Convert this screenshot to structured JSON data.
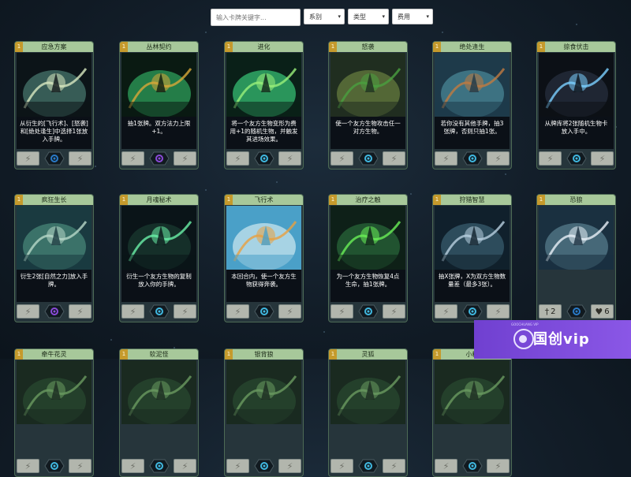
{
  "filters": {
    "search_placeholder": "输入卡牌关键字...",
    "series": "系别",
    "type": "类型",
    "cost": "费用"
  },
  "cards": [
    {
      "title": "应急方案",
      "cost": "1",
      "desc": "从衍生的[飞行术]、[怒袭]和[绝处逢生]中选择1张放入手牌。",
      "footer": "spell",
      "gem": "blue",
      "colors": [
        "#0c1418",
        "#4a7a70",
        "#d8e8c0"
      ]
    },
    {
      "title": "丛林契约",
      "cost": "1",
      "desc": "抽1张牌。双方法力上限+1。",
      "footer": "spell",
      "gem": "purple",
      "colors": [
        "#0a1a12",
        "#2fa860",
        "#d8a838"
      ]
    },
    {
      "title": "进化",
      "cost": "1",
      "desc": "将一个友方生物变形为费用+1的随机生物，并触发其进场效果。",
      "footer": "spell",
      "gem": "cyan",
      "colors": [
        "#0a2018",
        "#38c878",
        "#9af07a"
      ]
    },
    {
      "title": "怒袭",
      "cost": "1",
      "desc": "使一个友方生物攻击任一对方生物。",
      "footer": "spell",
      "gem": "cyan",
      "colors": [
        "#202e20",
        "#6a8040",
        "#4aa040"
      ]
    },
    {
      "title": "绝处逢生",
      "cost": "1",
      "desc": "若你没有其他手牌，抽3张牌，否则只抽1张。",
      "footer": "spell",
      "gem": "cyan",
      "colors": [
        "#1e3a4a",
        "#4a8a9a",
        "#c07a40"
      ]
    },
    {
      "title": "掠食伏击",
      "cost": "1",
      "desc": "从牌库将2张随机生物卡放入手中。",
      "footer": "spell",
      "gem": "cyan",
      "colors": [
        "#0c1016",
        "#283040",
        "#7ad0ff"
      ]
    },
    {
      "title": "疯狂生长",
      "cost": "1",
      "desc": "衍生2张[自然之力]放入手牌。",
      "footer": "spell",
      "gem": "purple",
      "colors": [
        "#1a3a40",
        "#4a8a7a",
        "#b8d8c8"
      ]
    },
    {
      "title": "月魂秘术",
      "cost": "1",
      "desc": "衍生一个友方生物的复制放入你的手牌。",
      "footer": "spell",
      "gem": "cyan",
      "colors": [
        "#0a1418",
        "#1a3a30",
        "#6af0a8"
      ]
    },
    {
      "title": "飞行术",
      "cost": "1",
      "desc": "本回合内，使一个友方生物获得奔袭。",
      "footer": "spell",
      "gem": "cyan",
      "colors": [
        "#4aa0c8",
        "#cfe8f0",
        "#e8a040"
      ]
    },
    {
      "title": "治疗之触",
      "cost": "1",
      "desc": "为一个友方生物恢复4点生命，抽1张牌。",
      "footer": "spell",
      "gem": "cyan",
      "colors": [
        "#0e2018",
        "#2a6a3a",
        "#6af058"
      ]
    },
    {
      "title": "狩猎智慧",
      "cost": "1",
      "desc": "抽X张牌，X为双方生物数量差（最多3张）。",
      "footer": "spell",
      "gem": "cyan",
      "colors": [
        "#10202c",
        "#3a6070",
        "#b8d0e0"
      ]
    },
    {
      "title": "恐狼",
      "cost": "1",
      "desc": "",
      "footer": "creature",
      "gem": "blue",
      "attack": "2",
      "health": "6",
      "colors": [
        "#1a3040",
        "#5a8090",
        "#e8f0f8"
      ]
    },
    {
      "title": "牵牛花灵",
      "cost": "1",
      "desc": "",
      "footer": "spell",
      "gem": "cyan",
      "colors": [
        "#1a2a20",
        "#2a4a30",
        "#6a9a60"
      ]
    },
    {
      "title": "软泥怪",
      "cost": "1",
      "desc": "",
      "footer": "spell",
      "gem": "cyan",
      "colors": [
        "#1a2a20",
        "#2a4a30",
        "#6a9a60"
      ]
    },
    {
      "title": "银背狼",
      "cost": "1",
      "desc": "",
      "footer": "spell",
      "gem": "cyan",
      "colors": [
        "#1a2a20",
        "#2a4a30",
        "#6a9a60"
      ]
    },
    {
      "title": "灵狐",
      "cost": "1",
      "desc": "",
      "footer": "spell",
      "gem": "cyan",
      "colors": [
        "#1a2a20",
        "#2a4a30",
        "#6a9a60"
      ]
    },
    {
      "title": "小精",
      "cost": "1",
      "desc": "",
      "footer": "spell",
      "gem": "cyan",
      "colors": [
        "#1a2a20",
        "#2a4a30",
        "#6a9a60"
      ]
    }
  ],
  "watermark": {
    "text": "国创vip",
    "small": "GOOCHUANG VIP"
  }
}
